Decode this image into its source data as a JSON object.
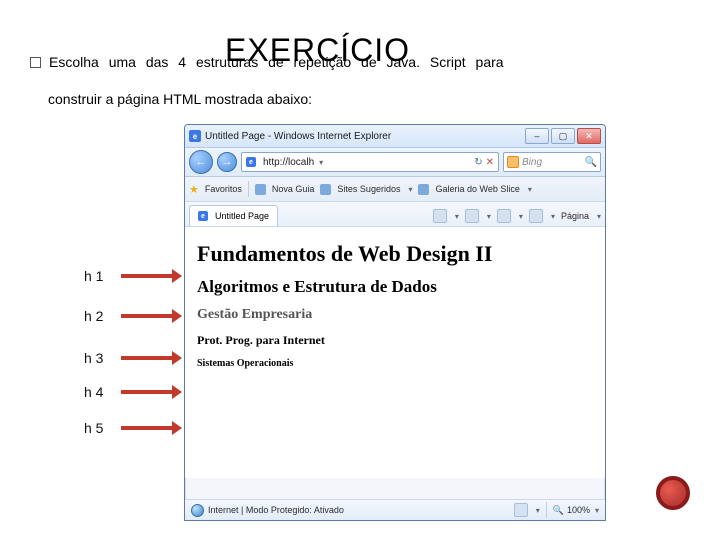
{
  "slide": {
    "title": "EXERCÍCIO",
    "line1": "Escolha uma das 4 estruturas de repetição de Java. Script para",
    "line2": "construir a página HTML mostrada abaixo:"
  },
  "browser": {
    "window_title": "Untitled Page - Windows Internet Explorer",
    "nav": {
      "back_glyph": "←",
      "fwd_glyph": "→",
      "url": "http://localh",
      "refresh_glyph": "↻",
      "stop_glyph": "✕",
      "search_engine": "Bing",
      "search_glyph": "🔍"
    },
    "favorites": {
      "label": "Favoritos",
      "items": [
        "Nova Guia",
        "Sites Sugeridos",
        "Galeria do Web Slice"
      ]
    },
    "tab": {
      "label": "Untitled Page",
      "tools": {
        "pagina": "Página",
        "dropdown_glyph": "▾"
      }
    },
    "page": {
      "h1": "Fundamentos de Web Design II",
      "h2": "Algoritmos e Estrutura de Dados",
      "h3": "Gestão Empresaria",
      "h4": "Prot. Prog. para Internet",
      "h5": "Sistemas Operacionais"
    },
    "status": {
      "text": "Internet | Modo Protegido: Ativado",
      "zoom": "100%"
    },
    "win_buttons": {
      "min": "–",
      "max": "▢",
      "close": "✕"
    }
  },
  "labels": {
    "h1": "h 1",
    "h2": "h 2",
    "h3": "h 3",
    "h4": "h 4",
    "h5": "h 5"
  }
}
